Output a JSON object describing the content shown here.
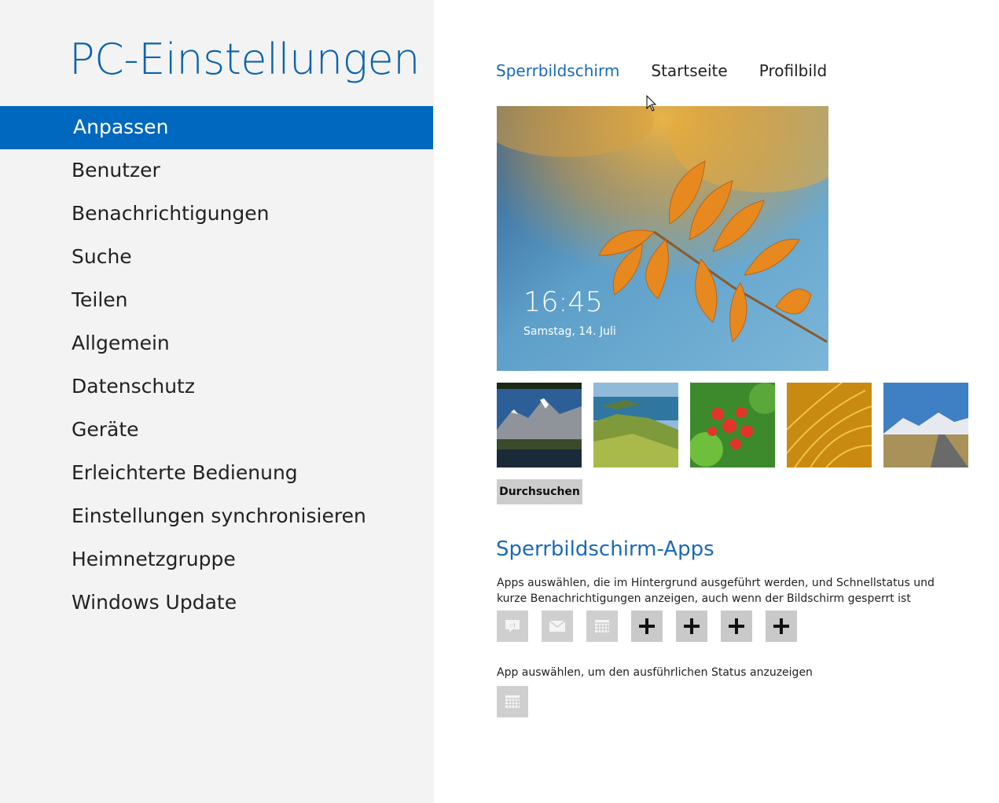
{
  "app": {
    "title": "PC-Einstellungen"
  },
  "sidebar": {
    "items": [
      {
        "label": "Anpassen",
        "selected": true
      },
      {
        "label": "Benutzer"
      },
      {
        "label": "Benachrichtigungen"
      },
      {
        "label": "Suche"
      },
      {
        "label": "Teilen"
      },
      {
        "label": "Allgemein"
      },
      {
        "label": "Datenschutz"
      },
      {
        "label": "Geräte"
      },
      {
        "label": "Erleichterte Bedienung"
      },
      {
        "label": "Einstellungen synchronisieren"
      },
      {
        "label": "Heimnetzgruppe"
      },
      {
        "label": "Windows Update"
      }
    ]
  },
  "tabs": [
    {
      "label": "Sperrbildschirm",
      "active": true
    },
    {
      "label": "Startseite"
    },
    {
      "label": "Profilbild"
    }
  ],
  "lock_preview": {
    "time": "16:45",
    "date": "Samstag, 14. Juli"
  },
  "backgrounds": [
    {
      "name": "mountain-lake"
    },
    {
      "name": "green-coast"
    },
    {
      "name": "red-flowers"
    },
    {
      "name": "golden-grass"
    },
    {
      "name": "mountain-road"
    }
  ],
  "browse_button": "Durchsuchen",
  "lock_apps": {
    "heading": "Sperrbildschirm-Apps",
    "description": "Apps auswählen, die im Hintergrund ausgeführt werden, und Schnellstatus und kurze Benachrichtigungen anzeigen, auch wenn der Bildschirm gesperrt ist",
    "slots": [
      {
        "icon": "messaging-icon"
      },
      {
        "icon": "mail-icon"
      },
      {
        "icon": "calendar-icon"
      },
      {
        "icon": "plus-icon"
      },
      {
        "icon": "plus-icon"
      },
      {
        "icon": "plus-icon"
      },
      {
        "icon": "plus-icon"
      }
    ],
    "detailed_label": "App auswählen, um den ausführlichen Status anzuzeigen",
    "detailed_icon": "calendar-icon"
  },
  "colors": {
    "accent": "#0068bf",
    "heading": "#1c6ab6",
    "sidebar_bg": "#f3f3f3"
  }
}
